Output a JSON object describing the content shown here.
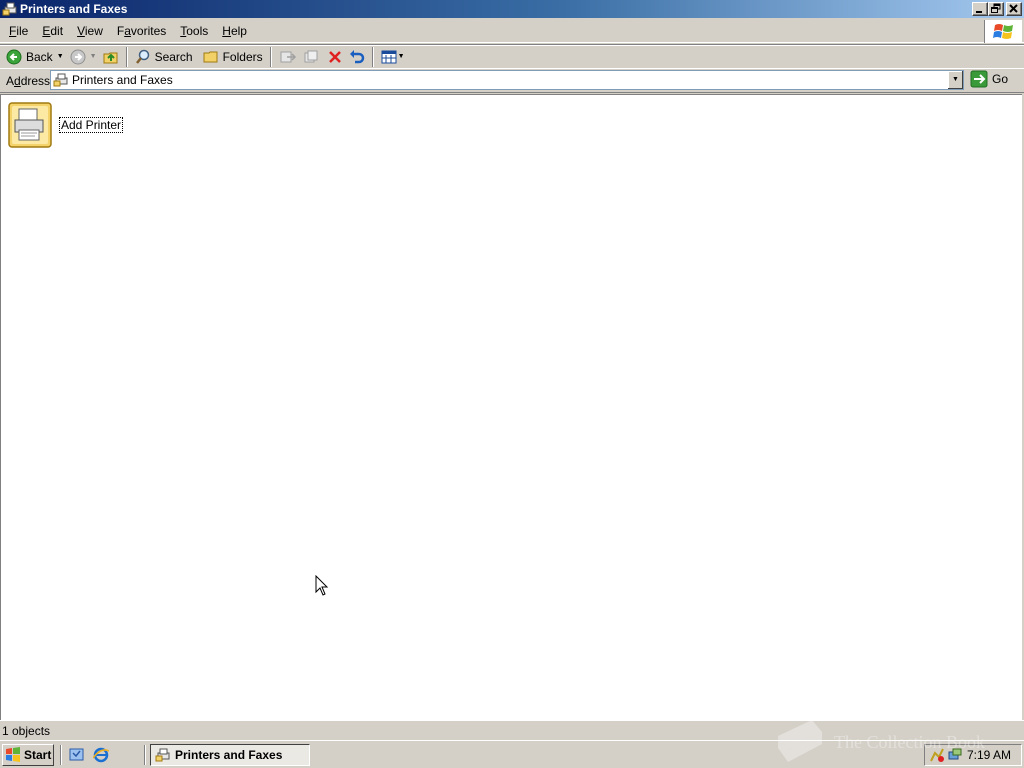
{
  "window": {
    "title": "Printers and Faxes",
    "controls": [
      "minimize",
      "restore",
      "close"
    ]
  },
  "menubar": {
    "items": [
      {
        "label": "File",
        "accel": "F",
        "rest": "ile"
      },
      {
        "label": "Edit",
        "accel": "E",
        "rest": "dit"
      },
      {
        "label": "View",
        "accel": "V",
        "rest": "iew"
      },
      {
        "label": "Favorites",
        "accel": "a",
        "pre": "F",
        "rest": "vorites"
      },
      {
        "label": "Tools",
        "accel": "T",
        "rest": "ools"
      },
      {
        "label": "Help",
        "accel": "H",
        "rest": "elp"
      }
    ]
  },
  "toolbar": {
    "back_label": "Back",
    "search_label": "Search",
    "folders_label": "Folders"
  },
  "address": {
    "label_accel": "d",
    "label_pre": "A",
    "label_rest": "dress",
    "value": "Printers and Faxes",
    "go_label": "Go"
  },
  "content": {
    "items": [
      {
        "label": "Add Printer",
        "icon": "add-printer-icon"
      }
    ]
  },
  "statusbar": {
    "text": "1 objects"
  },
  "taskbar": {
    "start_label": "Start",
    "task_label": "Printers and Faxes",
    "clock": "7:19 AM"
  },
  "watermark": {
    "text": "The Collection Book"
  },
  "colors": {
    "titlebar_start": "#0a246a",
    "titlebar_end": "#a6caf0",
    "face": "#d4d0c8",
    "delete_red": "#e02020",
    "go_green": "#3a9a3a"
  }
}
